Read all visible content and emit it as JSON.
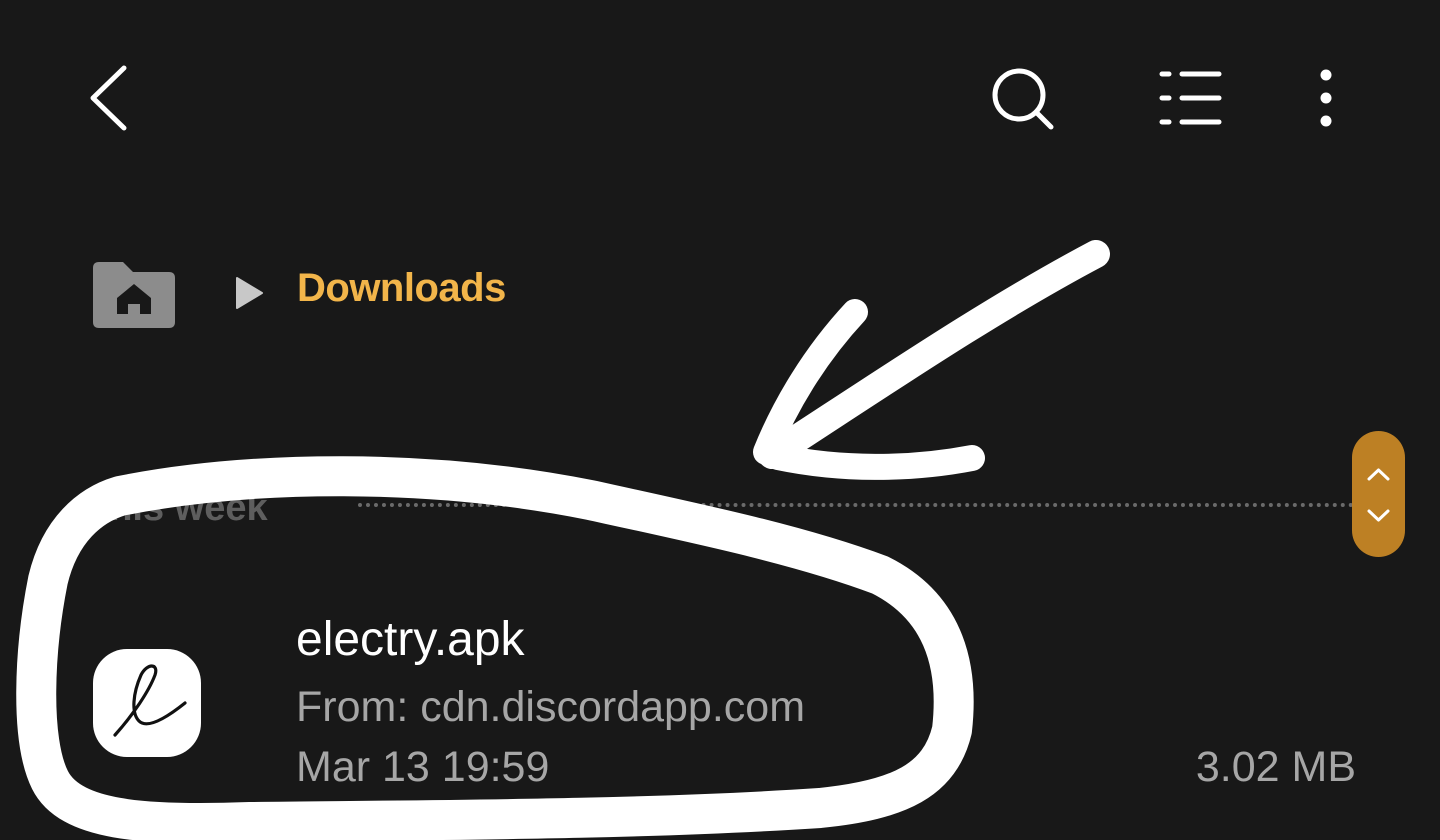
{
  "toolbar": {
    "back_icon": "back-arrow-icon",
    "search_icon": "search-icon",
    "view_icon": "list-view-icon",
    "more_icon": "more-options-icon"
  },
  "breadcrumb": {
    "home_icon": "home-folder-icon",
    "separator_icon": "play-arrow-icon",
    "current": "Downloads"
  },
  "section": {
    "label": "This week"
  },
  "fast_scroll": {
    "up_icon": "chevron-up-icon",
    "down_icon": "chevron-down-icon"
  },
  "files": [
    {
      "name": "electry.apk",
      "source": "From: cdn.discordapp.com",
      "date": "Mar 13 19:59",
      "size": "3.02 MB",
      "icon": "electry-app-icon"
    }
  ],
  "colors": {
    "background": "#181818",
    "accent": "#f2b54a",
    "scroll_pill": "#bd8024",
    "secondary_text": "#a6a6a6"
  }
}
